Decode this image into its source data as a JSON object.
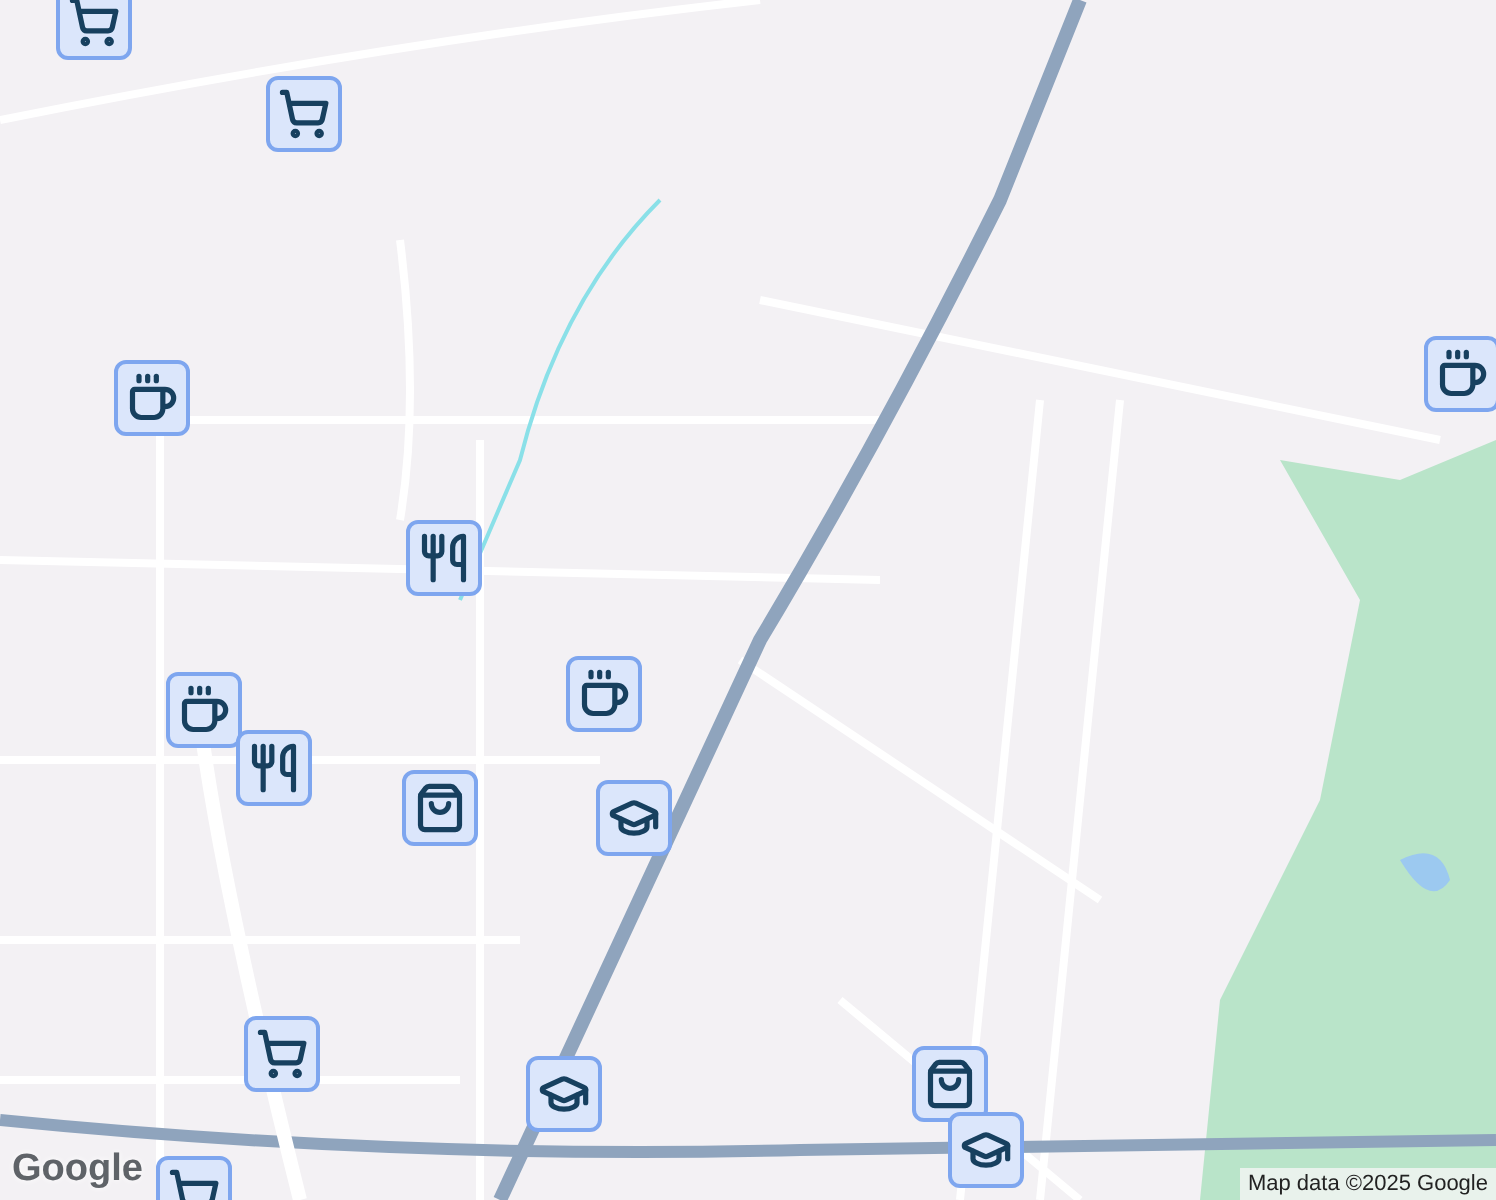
{
  "map": {
    "markers": [
      {
        "kind": "grocery"
      },
      {
        "kind": "grocery"
      },
      {
        "kind": "cafe"
      },
      {
        "kind": "restaurant"
      },
      {
        "kind": "cafe"
      },
      {
        "kind": "cafe"
      },
      {
        "kind": "restaurant"
      },
      {
        "kind": "shop"
      },
      {
        "kind": "school"
      },
      {
        "kind": "grocery"
      },
      {
        "kind": "school"
      },
      {
        "kind": "shop"
      },
      {
        "kind": "school"
      },
      {
        "kind": "cafe"
      },
      {
        "kind": "grocery"
      }
    ]
  },
  "logo": "Google",
  "attribution": "Map data ©2025 Google"
}
